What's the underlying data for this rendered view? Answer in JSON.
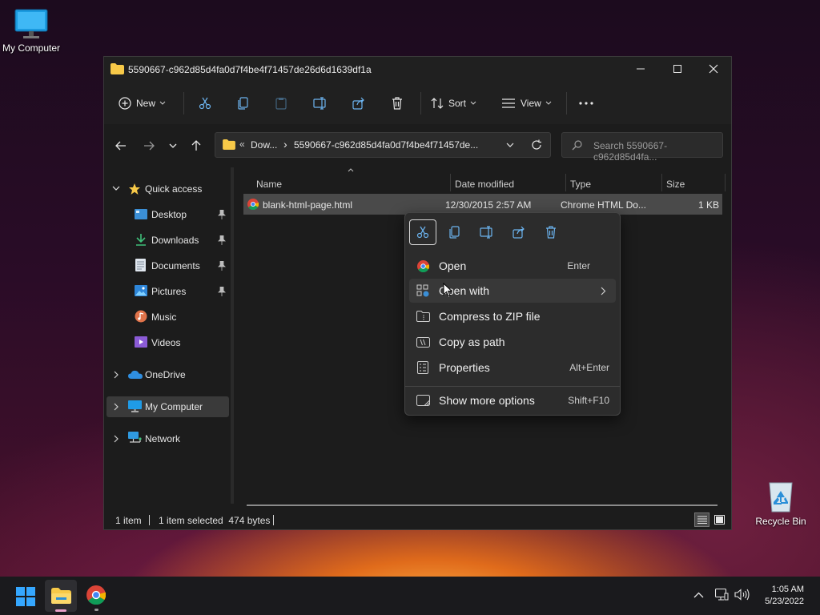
{
  "desktop": {
    "my_computer_label": "My Computer",
    "recycle_bin_label": "Recycle Bin"
  },
  "window": {
    "title": "5590667-c962d85d4fa0d7f4be4f71457de26d6d1639df1a"
  },
  "toolbar": {
    "new_label": "New",
    "sort_label": "Sort",
    "view_label": "View",
    "more_label": "..."
  },
  "address": {
    "prefix": "«",
    "crumb1": "Dow...",
    "sep": "›",
    "crumb2": "5590667-c962d85d4fa0d7f4be4f71457de...",
    "search_placeholder": "Search 5590667-c962d85d4fa..."
  },
  "sidebar": {
    "quick_access": "Quick access",
    "items": [
      {
        "label": "Desktop",
        "pinned": true
      },
      {
        "label": "Downloads",
        "pinned": true
      },
      {
        "label": "Documents",
        "pinned": true
      },
      {
        "label": "Pictures",
        "pinned": true
      },
      {
        "label": "Music",
        "pinned": false
      },
      {
        "label": "Videos",
        "pinned": false
      }
    ],
    "onedrive": "OneDrive",
    "my_computer": "My Computer",
    "network": "Network"
  },
  "columns": {
    "name": "Name",
    "date": "Date modified",
    "type": "Type",
    "size": "Size"
  },
  "file": {
    "name": "blank-html-page.html",
    "date": "12/30/2015 2:57 AM",
    "type": "Chrome HTML Do...",
    "size": "1 KB"
  },
  "context_menu": {
    "open": "Open",
    "open_shortcut": "Enter",
    "open_with": "Open with",
    "compress": "Compress to ZIP file",
    "copy_path": "Copy as path",
    "properties": "Properties",
    "properties_shortcut": "Alt+Enter",
    "more_options": "Show more options",
    "more_options_shortcut": "Shift+F10"
  },
  "status": {
    "count": "1 item",
    "selected": "1 item selected  474 bytes"
  },
  "taskbar": {
    "time": "1:05 AM",
    "date": "5/23/2022"
  },
  "colors": {
    "accent": "#0078d4",
    "folder": "#f7c948"
  }
}
